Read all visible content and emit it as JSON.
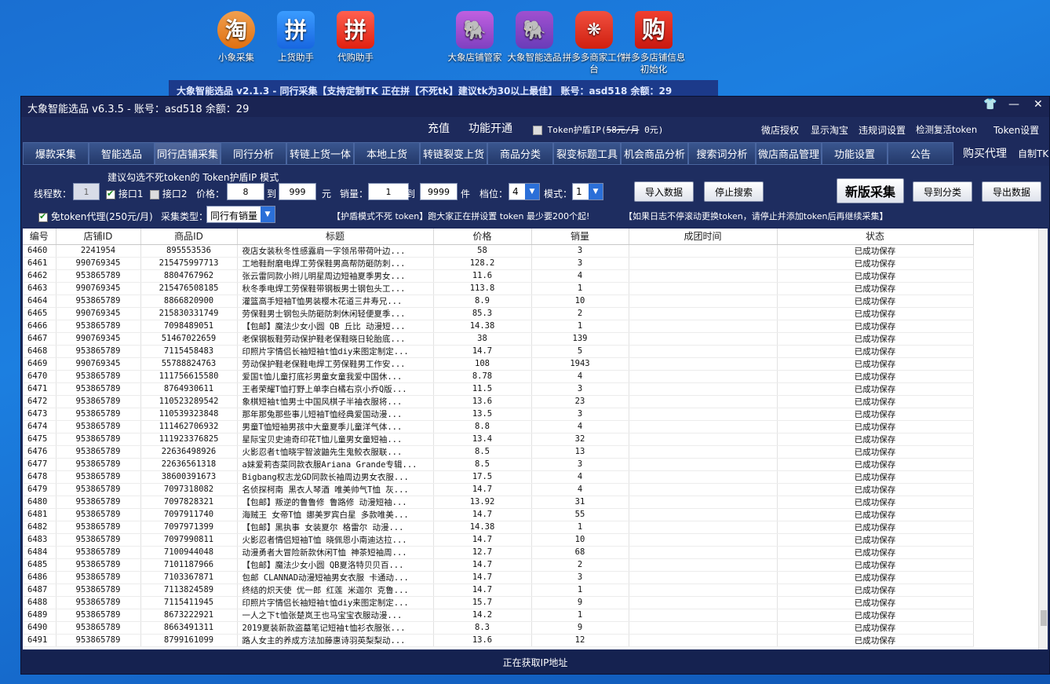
{
  "desktop": {
    "icons": [
      {
        "label": "小象采集",
        "glyph": "淘",
        "icon": "taobao-icon"
      },
      {
        "label": "上货助手",
        "glyph": "拼",
        "icon": "pinduoduo-icon"
      },
      {
        "label": "代购助手",
        "glyph": "拼",
        "icon": "pinduoduo-red-icon"
      },
      {
        "label": "大象店铺管家",
        "glyph": "🐘",
        "icon": "elephant-icon"
      },
      {
        "label": "大象智能选品",
        "glyph": "🐘",
        "icon": "elephant-icon"
      },
      {
        "label": "拼多多商家工作台",
        "glyph": "❋",
        "icon": "pdd-icon"
      },
      {
        "label": "拼多多店铺信息初始化",
        "glyph": "购",
        "icon": "gou-icon"
      }
    ]
  },
  "background_window": {
    "text": "大象智能选品 v2.1.3  -  同行采集【支持定制TK  正在拼【不死tk】建议tk为30以上最佳】  账号：asd518  余额：29"
  },
  "window": {
    "title": "大象智能选品 v6.3.5 - 账号：asd518 余额：29",
    "controls": {
      "skin": "👕",
      "minimize": "—",
      "close": "✕"
    },
    "top_menu": {
      "recharge": "充值",
      "activate": "功能开通",
      "token_ip_label": "Token护盾IP",
      "token_ip_price_old": "58元/月",
      "token_ip_price_new": "0元)",
      "token_ip_prefix": "(",
      "weidian_auth": "微店授权",
      "show_taobao": "显示淘宝",
      "banned_words": "违规词设置",
      "check_token": "检测复活token",
      "token_settings": "Token设置"
    },
    "tabs": [
      "爆款采集",
      "智能选品",
      "同行店铺采集",
      "同行分析",
      "转链上货一体",
      "本地上货",
      "转链裂变上货",
      "商品分类",
      "裂变标题工具",
      "机会商品分析",
      "搜索词分析",
      "微店商品管理",
      "功能设置",
      "公告"
    ],
    "active_tab": 2,
    "right_menu": {
      "buy_agent": "购买代理",
      "custom_tk": "自制TK"
    },
    "controls_panel": {
      "suggest": "建议勾选不死token的  Token护盾IP 模式",
      "threads_label": "线程数：",
      "threads_value": "1",
      "api1_label": "接口1",
      "api2_label": "接口2",
      "price_label": "价格：",
      "price_min": "8",
      "to1": "到",
      "price_max": "999",
      "yuan": "元",
      "sales_label": "销量：",
      "sales_min": "1",
      "to2": "到",
      "sales_max": "9999",
      "pieces": "件",
      "level_label": "档位：",
      "level_value": "4",
      "mode_label": "模式：",
      "mode_value": "1",
      "import_btn": "导入数据",
      "stop_btn": "停止搜索",
      "new_collect_btn": "新版采集",
      "to_category_btn": "导到分类",
      "export_btn": "导出数据",
      "free_token_label": "免token代理(250元/月)",
      "collect_type_label": "采集类型：",
      "collect_type_value": "同行有销量",
      "notice1": "【护盾模式不死 token】跑大家正在拼设置 token 最少要200个起!",
      "notice2": "【如果日志不停滚动更换token，请停止并添加token后再继续采集】"
    },
    "table": {
      "headers": [
        "编号",
        "店铺ID",
        "商品ID",
        "标题",
        "价格",
        "销量",
        "成团时间",
        "状态"
      ],
      "rows": [
        [
          "6460",
          "2241954",
          "895553536",
          "夜店女装秋冬性感露肩一字领吊带荷叶边...",
          "58",
          "3",
          "",
          "已成功保存"
        ],
        [
          "6461",
          "990769345",
          "215475997713",
          "工地鞋耐磨电焊工劳保鞋男高帮防砸防刺...",
          "128.2",
          "3",
          "",
          "已成功保存"
        ],
        [
          "6462",
          "953865789",
          "8804767962",
          "张云雷同款小辫儿明星周边短袖夏季男女...",
          "11.6",
          "4",
          "",
          "已成功保存"
        ],
        [
          "6463",
          "990769345",
          "215476508185",
          "秋冬季电焊工劳保鞋带钢板男士钢包头工...",
          "113.8",
          "1",
          "",
          "已成功保存"
        ],
        [
          "6464",
          "953865789",
          "8866820900",
          " 灌篮高手短袖T恤男装樱木花道三井寿兄...",
          "8.9",
          "10",
          "",
          "已成功保存"
        ],
        [
          "6465",
          "990769345",
          "215830331749",
          "劳保鞋男士钢包头防砸防刺休闲轻便夏季...",
          "85.3",
          "2",
          "",
          "已成功保存"
        ],
        [
          "6466",
          "953865789",
          "7098489051",
          " 【包邮】魔法少女小圆 QB 丘比 动漫短...",
          "14.38",
          "1",
          "",
          "已成功保存"
        ],
        [
          "6467",
          "990769345",
          "51467022659",
          "老保钢板鞋劳动保护鞋老保鞋晓日轮胎底...",
          "38",
          "139",
          "",
          "已成功保存"
        ],
        [
          "6468",
          "953865789",
          "7115458483",
          "印照片字情侣长袖短袖t恤diy来图定制定...",
          "14.7",
          "5",
          "",
          "已成功保存"
        ],
        [
          "6469",
          "990769345",
          "55788824763",
          "劳动保护鞋老保鞋电焊工劳保鞋男工作安...",
          "108",
          "1943",
          "",
          "已成功保存"
        ],
        [
          "6470",
          "953865789",
          "111756615580",
          " 爱国t恤儿童打底衫男童女童我爱中国休...",
          "8.78",
          "4",
          "",
          "已成功保存"
        ],
        [
          "6471",
          "953865789",
          "8764930611",
          "王者荣耀T恤打野上单李白橘右京小乔Q版...",
          "11.5",
          "3",
          "",
          "已成功保存"
        ],
        [
          "6472",
          "953865789",
          "110523289542",
          " 象棋短袖t恤男士中国风棋子半袖衣服将...",
          "13.6",
          "23",
          "",
          "已成功保存"
        ],
        [
          "6473",
          "953865789",
          "110539323848",
          " 那年那兔那些事儿短袖T恤经典爱国动漫...",
          "13.5",
          "3",
          "",
          "已成功保存"
        ],
        [
          "6474",
          "953865789",
          "111462706932",
          " 男童T恤短袖男孩中大童夏季儿童洋气体...",
          "8.8",
          "4",
          "",
          "已成功保存"
        ],
        [
          "6475",
          "953865789",
          "111923376825",
          " 星际宝贝史迪奇印花T恤儿童男女童短袖...",
          "13.4",
          "32",
          "",
          "已成功保存"
        ],
        [
          "6476",
          "953865789",
          "22636498926",
          " 火影忍者t恤晓宇智波鼬先生鬼鲛衣服联...",
          "8.5",
          "13",
          "",
          "已成功保存"
        ],
        [
          "6477",
          "953865789",
          "22636561318",
          "a妹爱莉杏菜同款衣服Ariana Grande专辑...",
          "8.5",
          "3",
          "",
          "已成功保存"
        ],
        [
          "6478",
          "953865789",
          "38600391673",
          " Bigbang权志龙GD同款长袖周边男女衣服...",
          "17.5",
          "4",
          "",
          "已成功保存"
        ],
        [
          "6479",
          "953865789",
          "7097318082",
          "名侦探柯南 黑衣人琴酒 唯美帅气T恤 灰...",
          "14.7",
          "4",
          "",
          "已成功保存"
        ],
        [
          "6480",
          "953865789",
          "7097828321",
          " 【包邮】叛逆的鲁鲁修 鲁路修 动漫短袖...",
          "13.92",
          "31",
          "",
          "已成功保存"
        ],
        [
          "6481",
          "953865789",
          "7097911740",
          "海贼王 女帝T恤 娜美罗宾白星 多款唯美...",
          "14.7",
          "55",
          "",
          "已成功保存"
        ],
        [
          "6482",
          "953865789",
          "7097971399",
          " 【包邮】黑执事 女装夏尔 格雷尔 动漫...",
          "14.38",
          "1",
          "",
          "已成功保存"
        ],
        [
          "6483",
          "953865789",
          "7097990811",
          "火影忍者情侣短袖T恤 晓佩恩小南迪达拉...",
          "14.7",
          "10",
          "",
          "已成功保存"
        ],
        [
          "6484",
          "953865789",
          "7100944048",
          "动漫勇者大冒险新款休闲T恤 神茶短袖周...",
          "12.7",
          "68",
          "",
          "已成功保存"
        ],
        [
          "6485",
          "953865789",
          "7101187966",
          " 【包邮】魔法少女小圆 QB夏洛特贝贝百...",
          "14.7",
          "2",
          "",
          "已成功保存"
        ],
        [
          "6486",
          "953865789",
          "7103367871",
          " 包邮 CLANNAD动漫短袖男女衣服 卡通动...",
          "14.7",
          "3",
          "",
          "已成功保存"
        ],
        [
          "6487",
          "953865789",
          "7113824589",
          "终结的炽天使 优一郎 红莲 米迦尔 克鲁...",
          "14.7",
          "1",
          "",
          "已成功保存"
        ],
        [
          "6488",
          "953865789",
          "7115411945",
          "印照片字情侣长袖短袖t恤diy来图定制定...",
          "15.7",
          "9",
          "",
          "已成功保存"
        ],
        [
          "6489",
          "953865789",
          "8673222921",
          " 一人之下t恤张楚岚王也马宝宝衣服动漫...",
          "14.2",
          "1",
          "",
          "已成功保存"
        ],
        [
          "6490",
          "953865789",
          "8663491311",
          " 2019夏装新款盗墓笔记短袖t恤衫衣服张...",
          "8.3",
          "9",
          "",
          "已成功保存"
        ],
        [
          "6491",
          "953865789",
          "8799161099",
          "路人女主的养成方法加藤惠诗羽英梨梨动...",
          "13.6",
          "12",
          "",
          "已成功保存"
        ]
      ]
    },
    "status_text": "正在获取IP地址"
  }
}
